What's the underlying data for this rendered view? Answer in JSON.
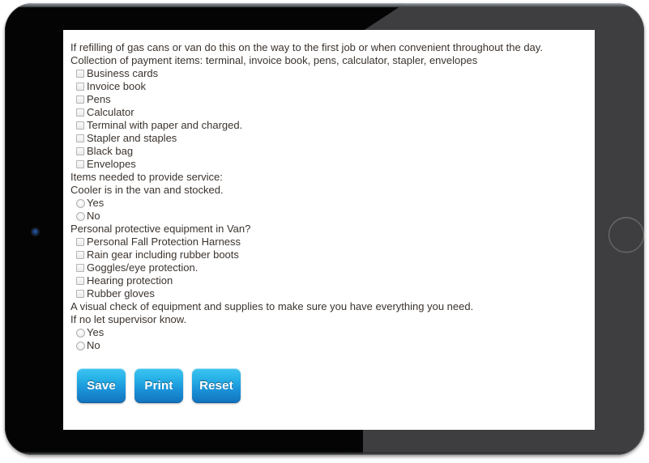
{
  "device": {
    "kind": "tablet-mockup",
    "bezel_color_left": "#040404",
    "bezel_color_right": "#3e3e40",
    "screen_bg": "#ffffff"
  },
  "form": {
    "text_color": "#3b342f",
    "intro_lines": [
      "If refilling of gas cans or van do this on the way to the first job or when convenient throughout the day.",
      "Collection of payment items: terminal, invoice book, pens, calculator, stapler, envelopes"
    ],
    "payment_items": [
      {
        "label": "Business cards",
        "type": "checkbox",
        "checked": false
      },
      {
        "label": "Invoice book",
        "type": "checkbox",
        "checked": false
      },
      {
        "label": "Pens",
        "type": "checkbox",
        "checked": false
      },
      {
        "label": "Calculator",
        "type": "checkbox",
        "checked": false
      },
      {
        "label": "Terminal with paper and charged.",
        "type": "checkbox",
        "checked": false
      },
      {
        "label": "Stapler and staples",
        "type": "checkbox",
        "checked": false
      },
      {
        "label": "Black bag",
        "type": "checkbox",
        "checked": false
      },
      {
        "label": "Envelopes",
        "type": "checkbox",
        "checked": false
      }
    ],
    "service_heading": "Items needed to provide service:",
    "cooler_question": "Cooler is in the van and stocked.",
    "cooler_options": [
      {
        "label": "Yes",
        "type": "radio",
        "checked": false
      },
      {
        "label": "No",
        "type": "radio",
        "checked": false
      }
    ],
    "ppe_question": "Personal protective equipment in Van?",
    "ppe_items": [
      {
        "label": "Personal Fall Protection Harness",
        "type": "checkbox",
        "checked": false
      },
      {
        "label": "Rain gear including rubber boots",
        "type": "checkbox",
        "checked": false
      },
      {
        "label": "Goggles/eye protection.",
        "type": "checkbox",
        "checked": false
      },
      {
        "label": "Hearing protection",
        "type": "checkbox",
        "checked": false
      },
      {
        "label": "Rubber gloves",
        "type": "checkbox",
        "checked": false
      }
    ],
    "visual_check_lines": [
      "A visual check of equipment and supplies to make sure you have everything you need.",
      "If no let supervisor know."
    ],
    "visual_check_options": [
      {
        "label": "Yes",
        "type": "radio",
        "checked": false
      },
      {
        "label": "No",
        "type": "radio",
        "checked": false
      }
    ],
    "buttons": [
      {
        "label": "Save",
        "name": "save-button"
      },
      {
        "label": "Print",
        "name": "print-button"
      },
      {
        "label": "Reset",
        "name": "reset-button"
      }
    ],
    "button_color": "#28b3e8"
  }
}
